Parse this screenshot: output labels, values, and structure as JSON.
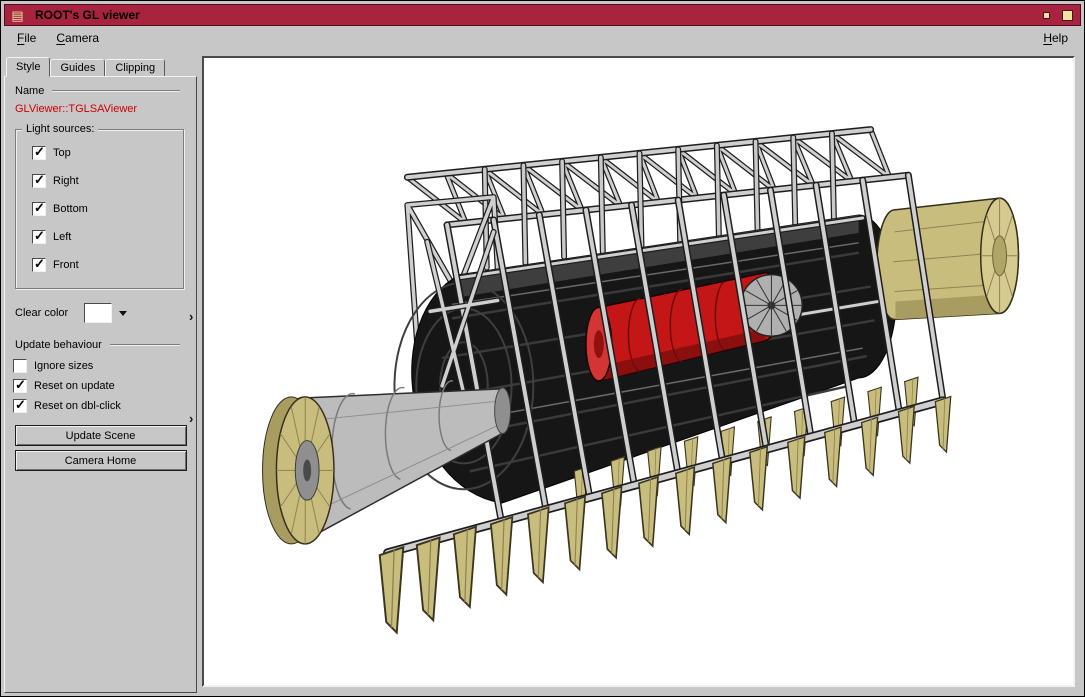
{
  "window": {
    "title": "ROOT's GL viewer",
    "controls": [
      {
        "name": "window-menu-button",
        "icon": "window-menu-icon"
      },
      {
        "name": "iconify-button",
        "icon": "iconify-icon"
      },
      {
        "name": "maximize-button",
        "icon": "maximize-icon"
      }
    ]
  },
  "menubar": {
    "file": {
      "mn": "F",
      "rest": "ile"
    },
    "camera": {
      "mn": "C",
      "rest": "amera"
    },
    "help": {
      "mn": "H",
      "rest": "elp"
    }
  },
  "sidebar": {
    "tabs": [
      {
        "label": "Style",
        "active": true
      },
      {
        "label": "Guides",
        "active": false
      },
      {
        "label": "Clipping",
        "active": false
      }
    ],
    "name_label": "Name",
    "viewer_name": "GLViewer::TGLSAViewer",
    "light_sources": {
      "title": "Light sources:",
      "options": [
        {
          "label": "Top",
          "checked": true
        },
        {
          "label": "Right",
          "checked": true
        },
        {
          "label": "Bottom",
          "checked": true
        },
        {
          "label": "Left",
          "checked": true
        },
        {
          "label": "Front",
          "checked": true
        }
      ]
    },
    "clear_color": {
      "label": "Clear color",
      "value": "#ffffff"
    },
    "update_behaviour": {
      "label": "Update behaviour",
      "options": [
        {
          "label": "Ignore sizes",
          "checked": false
        },
        {
          "label": "Reset on update",
          "checked": true
        },
        {
          "label": "Reset on dbl-click",
          "checked": true
        }
      ]
    },
    "buttons": [
      {
        "label": "Update Scene"
      },
      {
        "label": "Camera Home"
      }
    ]
  },
  "colors": {
    "titlebar": "#a8233e",
    "chrome_gray": "#c7c7c7",
    "viewer_name_text": "#cc0000",
    "viewport_background": "#ffffff",
    "scene_frame_gray": "#cfcfcf",
    "scene_barrel_black": "#161616",
    "scene_inner_cylinder_red": "#c41616",
    "scene_endcap_tan": "#c9bd7d"
  }
}
